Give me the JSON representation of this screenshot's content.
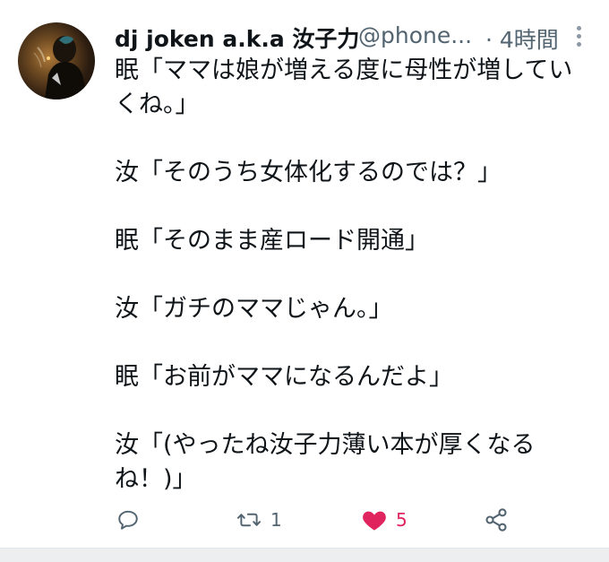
{
  "tweet": {
    "display_name": "dj joken a.k.a 汝子力",
    "handle": "@phone...",
    "separator": "·",
    "time": "4時間",
    "body_lines": [
      "眠「ママは娘が増える度に母性が増してい",
      "くね。」",
      "",
      "汝「そのうち女体化するのでは？」",
      "",
      "眠「そのまま産ロード開通」",
      "",
      "汝「ガチのママじゃん。」",
      "",
      "眠「お前がママになるんだよ」",
      "",
      "汝「(やったね汝子力薄い本が厚くなる",
      "ね！)」"
    ],
    "actions": {
      "reply_icon": "reply-icon",
      "retweet_icon": "retweet-icon",
      "retweet_count": "1",
      "like_icon": "heart-icon",
      "like_count": "5",
      "like_color": "#e0245e",
      "share_icon": "share-icon"
    },
    "colors": {
      "text": "#0f1419",
      "muted": "#536471"
    }
  }
}
